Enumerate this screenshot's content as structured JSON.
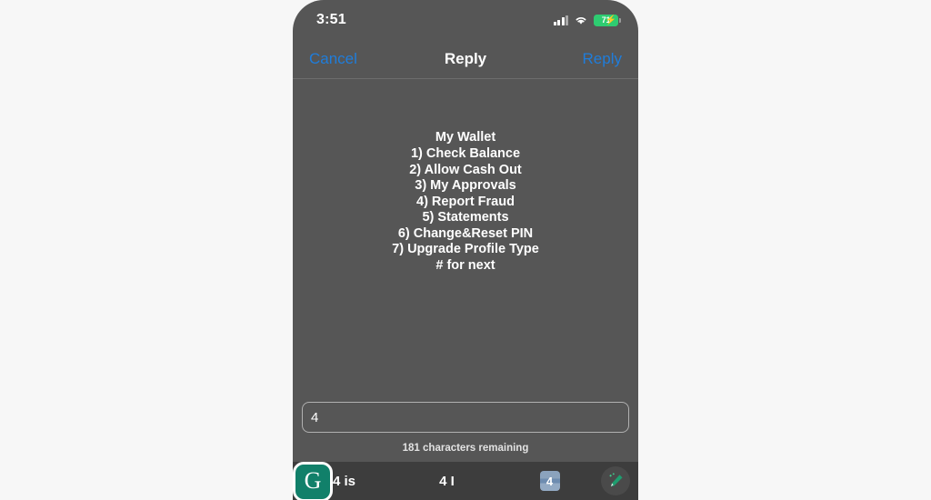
{
  "status_bar": {
    "time": "3:51",
    "signal_icon": "cellular-signal-icon",
    "wifi_icon": "wifi-icon",
    "battery_level": "71",
    "battery_charging_icon": "lightning-bolt-icon",
    "battery_color": "#2ecc71"
  },
  "nav_bar": {
    "cancel_label": "Cancel",
    "title": "Reply",
    "reply_label": "Reply",
    "accent_color": "#1f7ddb"
  },
  "message": {
    "lines": [
      "My Wallet",
      "1) Check Balance",
      "2) Allow Cash Out",
      "3) My Approvals",
      "4) Report Fraud",
      "5) Statements",
      "6) Change&Reset PIN",
      "7) Upgrade Profile Type",
      "# for next"
    ]
  },
  "input": {
    "value": "4",
    "placeholder": "",
    "char_counter": "181 characters remaining"
  },
  "keyboard_bar": {
    "grammarly_logo_letter": "G",
    "grammarly_brand_color": "#11806a",
    "suggestions": [
      {
        "label": "4 is"
      },
      {
        "label": "4 I"
      }
    ],
    "emoji_badge_label": "4",
    "assistant_icon": "pencil-icon",
    "background_color": "#3d3d3d"
  },
  "theme": {
    "page_background": "#f7f7f7",
    "screen_background": "#565656"
  }
}
